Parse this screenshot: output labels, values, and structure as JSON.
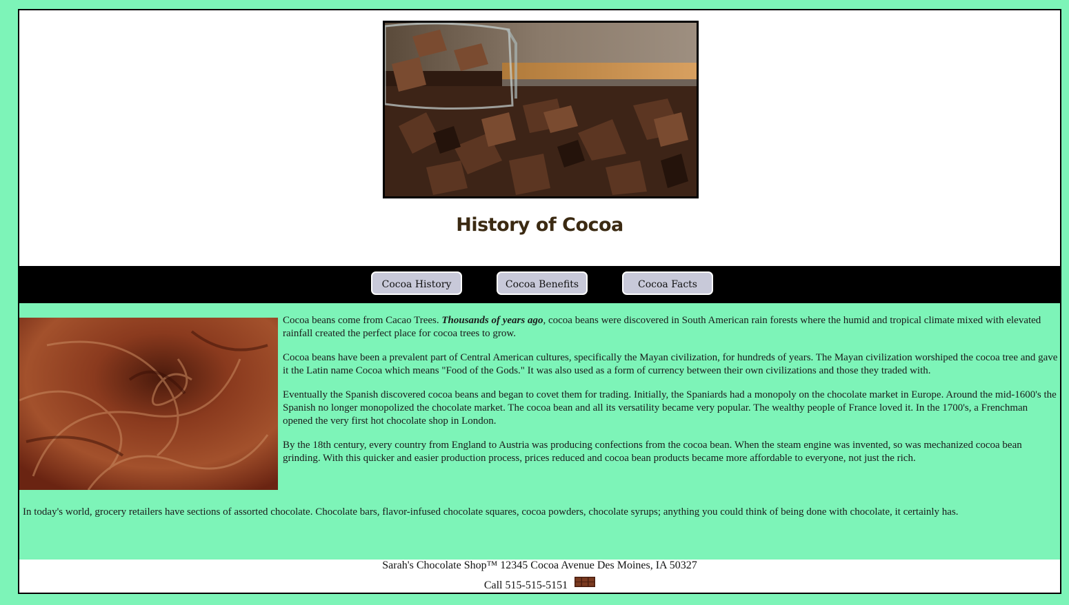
{
  "header": {
    "title": "History of Cocoa"
  },
  "nav": {
    "items": [
      {
        "label": "Cocoa History"
      },
      {
        "label": "Cocoa Benefits"
      },
      {
        "label": "Cocoa Facts"
      }
    ]
  },
  "content": {
    "p1_intro": "Cocoa beans come from Cacao Trees. ",
    "p1_emphasis": "Thousands of years ago",
    "p1_rest": ", cocoa beans were discovered in South American rain forests where the humid and tropical climate mixed with elevated rainfall created the perfect place for cocoa trees to grow.",
    "p2": "Cocoa beans have been a prevalent part of Central American cultures, specifically the Mayan civilization, for hundreds of years. The Mayan civilization worshiped the cocoa tree and gave it the Latin name Cocoa which means \"Food of the Gods.\" It was also used as a form of currency between their own civilizations and those they traded with.",
    "p3": "Eventually the Spanish discovered cocoa beans and began to covet them for trading. Initially, the Spaniards had a monopoly on the chocolate market in Europe. Around the mid-1600's the Spanish no longer monopolized the chocolate market. The cocoa bean and all its versatility became very popular. The wealthy people of France loved it. In the 1700's, a Frenchman opened the very first hot chocolate shop in London.",
    "p4": "By the 18th century, every country from England to Austria was producing confections from the cocoa bean. When the steam engine was invented, so was mechanized cocoa bean grinding. With this quicker and easier production process, prices reduced and cocoa bean products became more affordable to everyone, not just the rich.",
    "p5": "In today's world, grocery retailers have sections of assorted chocolate. Chocolate bars, flavor-infused chocolate squares, cocoa powders, chocolate syrups; anything you could think of being done with chocolate, it certainly has."
  },
  "footer": {
    "address": "Sarah's Chocolate Shop™ 12345 Cocoa Avenue Des Moines, IA 50327",
    "phone": "Call 515-515-5151"
  },
  "icons": {
    "footer_icon": "chocolate-bar-icon"
  },
  "colors": {
    "page_bg": "#7df4b8",
    "nav_bg": "#000000",
    "nav_button": "#c8c9d9",
    "title": "#3b2a12"
  }
}
